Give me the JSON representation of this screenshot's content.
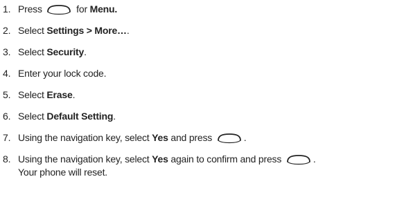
{
  "steps": [
    {
      "number": "1.",
      "parts": [
        {
          "type": "text",
          "text": "Press "
        },
        {
          "type": "key",
          "icon": "menu-key-icon"
        },
        {
          "type": "text",
          "text": " for "
        },
        {
          "type": "bold",
          "text": "Menu."
        }
      ]
    },
    {
      "number": "2.",
      "parts": [
        {
          "type": "text",
          "text": "Select "
        },
        {
          "type": "bold",
          "text": "Settings > More…"
        },
        {
          "type": "text",
          "text": "."
        }
      ]
    },
    {
      "number": "3.",
      "parts": [
        {
          "type": "text",
          "text": "Select "
        },
        {
          "type": "bold",
          "text": "Security"
        },
        {
          "type": "text",
          "text": "."
        }
      ]
    },
    {
      "number": "4.",
      "parts": [
        {
          "type": "text",
          "text": "Enter your lock code."
        }
      ]
    },
    {
      "number": "5.",
      "parts": [
        {
          "type": "text",
          "text": "Select "
        },
        {
          "type": "bold",
          "text": "Erase"
        },
        {
          "type": "text",
          "text": "."
        }
      ]
    },
    {
      "number": "6.",
      "parts": [
        {
          "type": "text",
          "text": "Select "
        },
        {
          "type": "bold",
          "text": "Default Setting"
        },
        {
          "type": "text",
          "text": "."
        }
      ]
    },
    {
      "number": "7.",
      "parts": [
        {
          "type": "text",
          "text": "Using the navigation key, select "
        },
        {
          "type": "bold",
          "text": "Yes"
        },
        {
          "type": "text",
          "text": " and press "
        },
        {
          "type": "key",
          "icon": "ok-key-icon"
        },
        {
          "type": "text",
          "text": "."
        }
      ]
    },
    {
      "number": "8.",
      "parts": [
        {
          "type": "text",
          "text": "Using the navigation key, select "
        },
        {
          "type": "bold",
          "text": "Yes"
        },
        {
          "type": "text",
          "text": " again to confirm and press "
        },
        {
          "type": "key",
          "icon": "ok-key-icon"
        },
        {
          "type": "text",
          "text": "."
        },
        {
          "type": "break"
        },
        {
          "type": "text",
          "text": "Your phone will reset."
        }
      ]
    }
  ]
}
